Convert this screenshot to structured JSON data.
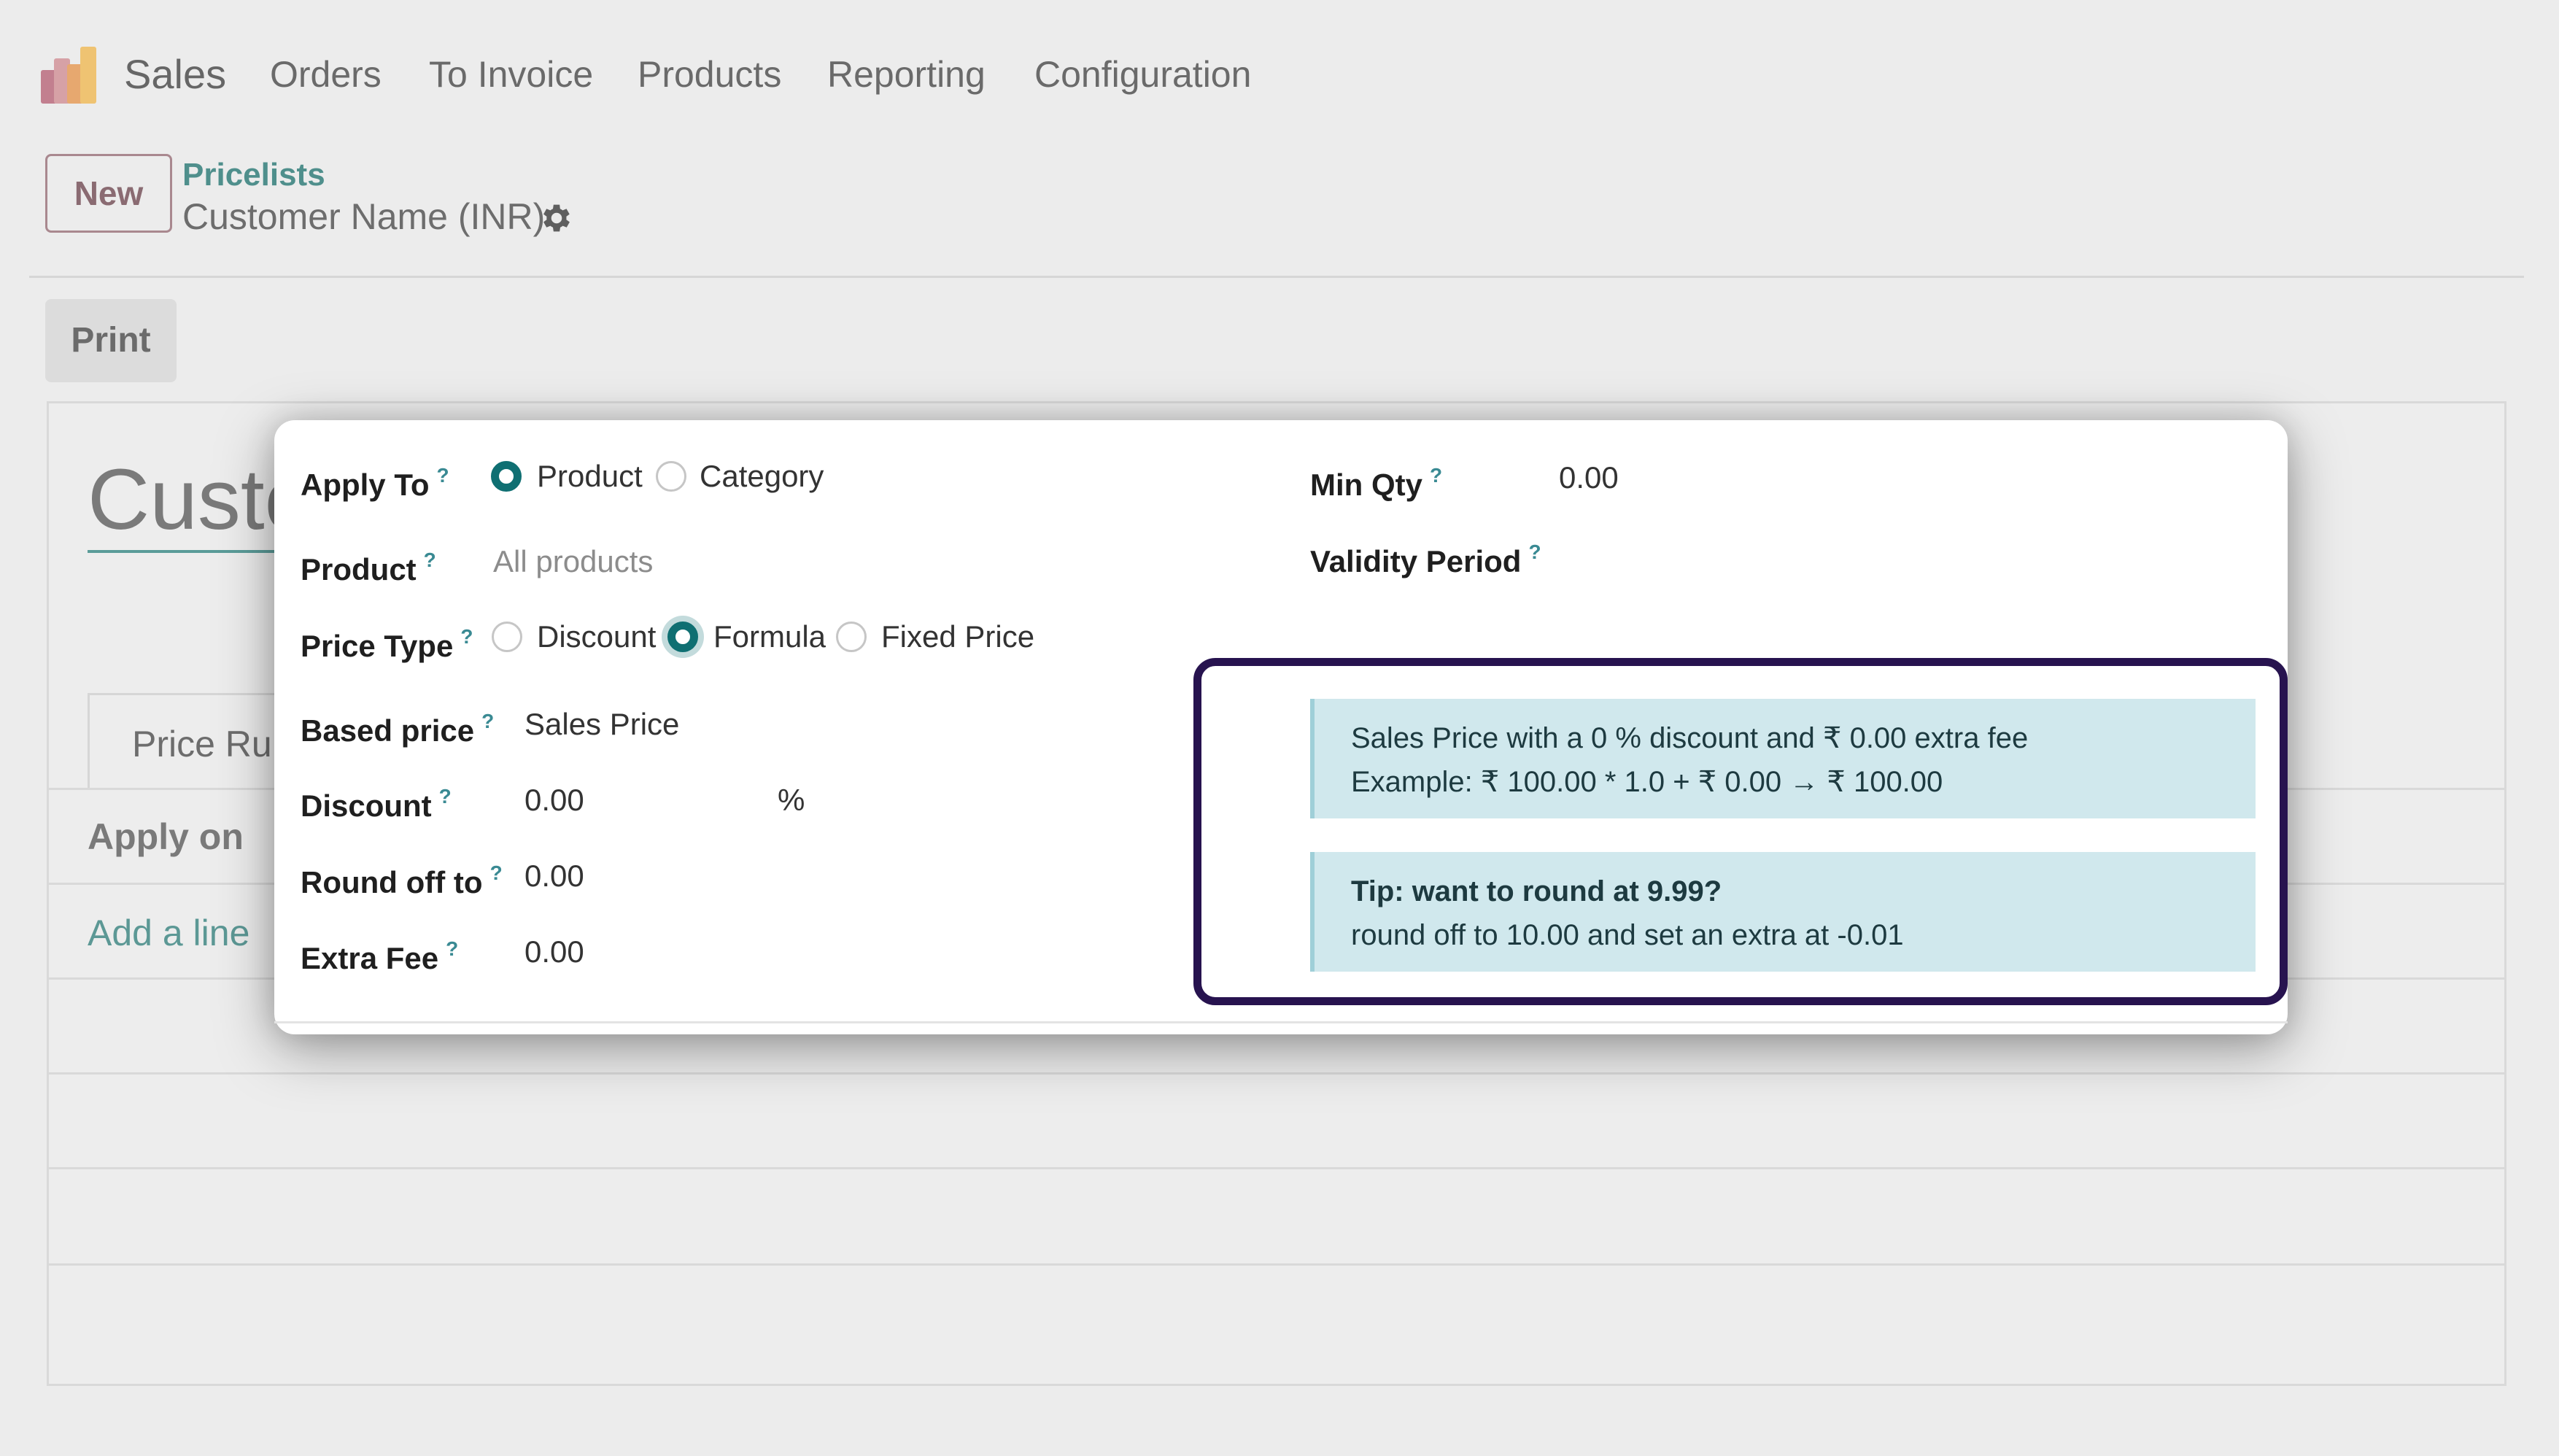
{
  "nav": {
    "app_name": "Sales",
    "items": [
      "Orders",
      "To Invoice",
      "Products",
      "Reporting",
      "Configuration"
    ]
  },
  "control_panel": {
    "new_label": "New",
    "breadcrumb_link": "Pricelists",
    "record_name": "Customer Name (INR)",
    "print_label": "Print"
  },
  "sheet": {
    "title_partial": "Custo",
    "tab_label": "Price Rules",
    "column_header": "Apply on",
    "add_line": "Add a line"
  },
  "dialog": {
    "help_mark": "?",
    "apply_to": {
      "label": "Apply To",
      "options": [
        "Product",
        "Category"
      ],
      "selected": "Product"
    },
    "product": {
      "label": "Product",
      "placeholder": "All products"
    },
    "price_type": {
      "label": "Price Type",
      "options": [
        "Discount",
        "Formula",
        "Fixed Price"
      ],
      "selected": "Formula"
    },
    "based_price": {
      "label": "Based price",
      "value": "Sales Price"
    },
    "discount": {
      "label": "Discount",
      "value": "0.00",
      "unit": "%"
    },
    "round_off": {
      "label": "Round off to",
      "value": "0.00"
    },
    "extra_fee": {
      "label": "Extra Fee",
      "value": "0.00"
    },
    "min_qty": {
      "label": "Min Qty",
      "value": "0.00"
    },
    "validity": {
      "label": "Validity Period"
    },
    "info_box": {
      "line1": "Sales Price with a 0 % discount and ₹ 0.00 extra fee",
      "line2": "Example: ₹ 100.00 * 1.0 + ₹ 0.00 → ₹ 100.00"
    },
    "tip_box": {
      "title": "Tip: want to round at 9.99?",
      "text": "round off to 10.00 and set an extra at -0.01"
    }
  },
  "colors": {
    "accent_teal": "#0f6f72",
    "highlight_frame": "#27134f",
    "alert_bg": "#d0e8ed"
  }
}
